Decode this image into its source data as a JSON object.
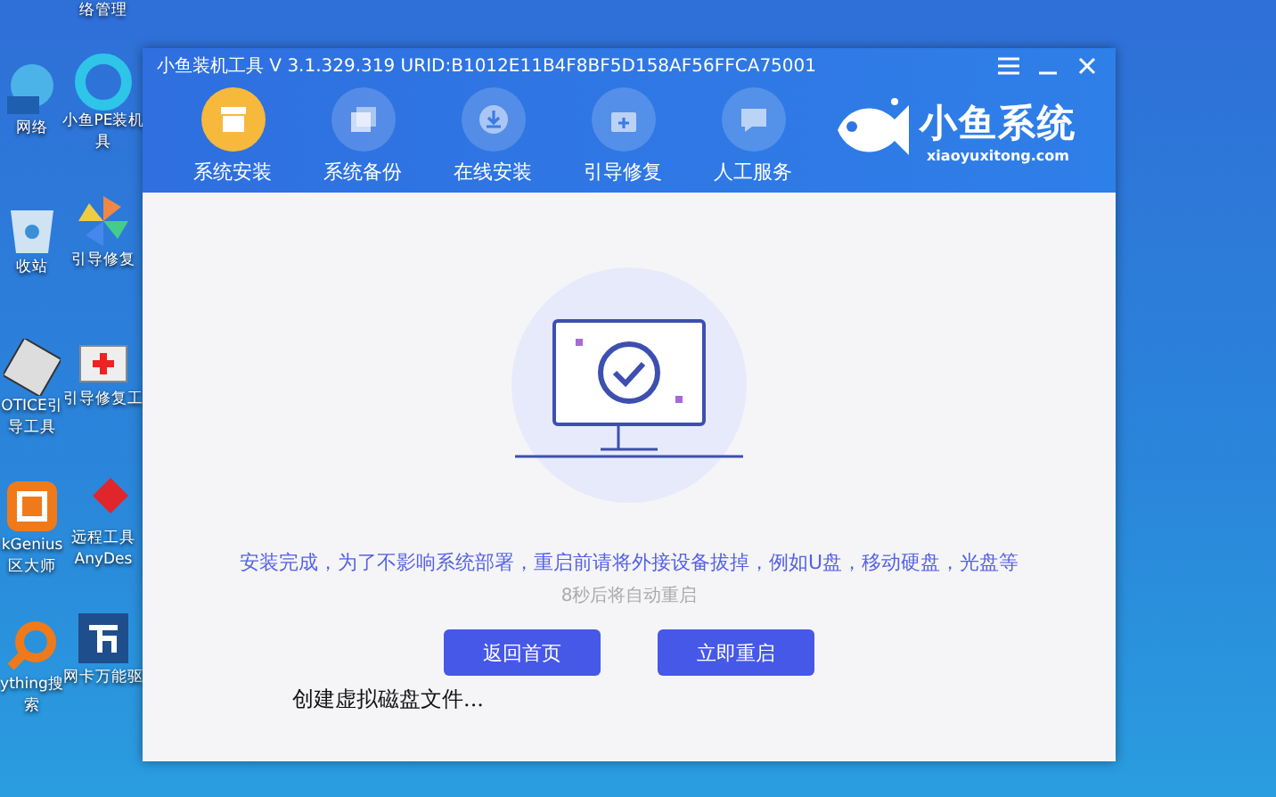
{
  "desktop": {
    "column_1": [
      {
        "kind": "globe",
        "label": [
          "网络"
        ]
      },
      {
        "kind": "bin",
        "label": [
          "收站"
        ]
      },
      {
        "kind": "disk",
        "label": [
          "OTICE引",
          "导工具"
        ]
      },
      {
        "kind": "genius",
        "label": [
          "kGenius",
          "区大师"
        ]
      },
      {
        "kind": "search",
        "label": [
          "ything搜",
          "索"
        ]
      }
    ],
    "column_2": [
      {
        "kind": "none",
        "label": [
          "络管理"
        ]
      },
      {
        "kind": "edge",
        "label": [
          "小鱼PE装机",
          "具"
        ]
      },
      {
        "kind": "pinwheel",
        "label": [
          "引导修复"
        ]
      },
      {
        "kind": "kit",
        "label": [
          "引导修复工"
        ]
      },
      {
        "kind": "diamond",
        "label": [
          "远程工具",
          "AnyDes"
        ]
      },
      {
        "kind": "wan",
        "label": [
          "网卡万能驱"
        ]
      }
    ]
  },
  "window": {
    "title": "小鱼装机工具 V 3.1.329.319 URID:B1012E11B4F8BF5D158AF56FFCA75001",
    "nav": [
      {
        "label": "系统安装",
        "kind": "install",
        "selected": true
      },
      {
        "label": "系统备份",
        "kind": "backup",
        "selected": false
      },
      {
        "label": "在线安装",
        "kind": "download",
        "selected": false
      },
      {
        "label": "引导修复",
        "kind": "repair",
        "selected": false
      },
      {
        "label": "人工服务",
        "kind": "chat",
        "selected": false
      }
    ],
    "logo": {
      "name": "小鱼系统",
      "url": "xiaoyuxitong.com"
    },
    "message": "安装完成，为了不影响系统部署，重启前请将外接设备拔掉，例如U盘，移动硬盘，光盘等",
    "countdown": "8秒后将自动重启",
    "buttons": [
      "返回首页",
      "立即重启"
    ],
    "overlay_text": "创建虚拟磁盘文件..."
  }
}
